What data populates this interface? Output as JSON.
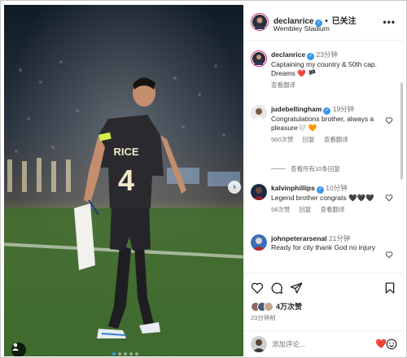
{
  "post": {
    "author": "declanrice",
    "follow_label": "已关注",
    "follow_dot": "•",
    "location": "Wembley Stadium",
    "more": "•••",
    "jersey_name": "RICE",
    "jersey_number": "4"
  },
  "caption": {
    "user": "declanrice",
    "time": "23分钟",
    "text": "Captaining my country & 50th cap. Dreams ❤️ 🏴",
    "translate": "查看翻译"
  },
  "comments": [
    {
      "user": "judebellingham",
      "time": "19分钟",
      "text": "Congratulations brother, always a pleasure🤍 🧡",
      "likes": "560次赞",
      "reply": "回复",
      "translate": "查看翻译",
      "view_replies": "查看所有10条回复"
    },
    {
      "user": "kalvinphillips",
      "time": "10分钟",
      "text": "Legend brother congrats 🖤🖤🖤",
      "likes": "58次赞",
      "reply": "回复",
      "translate": "查看翻译"
    },
    {
      "user": "johnpeterarsenal",
      "time": "21分钟",
      "text": "Ready for city thank God no injury"
    }
  ],
  "stats": {
    "likes": "4万次赞",
    "date": "23分钟前"
  },
  "composer": {
    "placeholder": "添加评论...",
    "emoji": "❤️"
  },
  "colors": {
    "verified": "#3897f0",
    "pitch": "#3f6b2e",
    "kit": "#2a2a2e"
  },
  "icons": [
    "heart-icon",
    "comment-icon",
    "share-icon",
    "bookmark-icon",
    "verified-icon",
    "user-tag-icon",
    "chevron-right-icon",
    "smiley-icon"
  ]
}
